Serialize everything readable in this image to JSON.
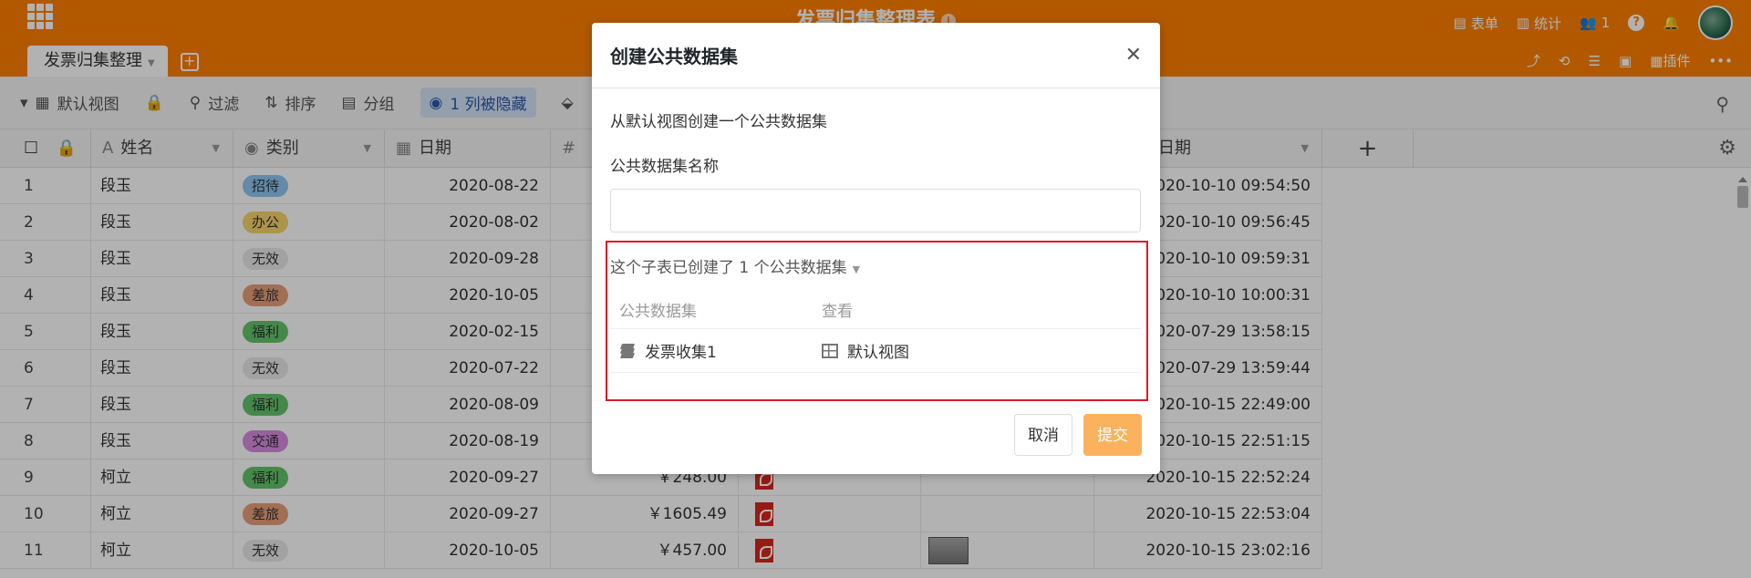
{
  "app": {
    "title": "发票归集整理表",
    "top_right": {
      "form": "表单",
      "stats": "统计",
      "users_count": "1",
      "plugins": "插件"
    },
    "tab": "发票归集整理"
  },
  "toolbar": {
    "view": "默认视图",
    "filter": "过滤",
    "sort": "排序",
    "group": "分组",
    "hidden": "1 列被隐藏"
  },
  "columns": {
    "name": "姓名",
    "category": "类别",
    "date": "日期",
    "last_date": "日期"
  },
  "rows": [
    {
      "no": "1",
      "name": "段玉",
      "cat": "招待",
      "cat_color": "#8fc6f3",
      "date": "2020-08-22",
      "amount": "",
      "pdf": false,
      "img": false,
      "dt": "2020-10-10 09:54:50"
    },
    {
      "no": "2",
      "name": "段玉",
      "cat": "办公",
      "cat_color": "#f7d56b",
      "date": "2020-08-02",
      "amount": "",
      "pdf": false,
      "img": false,
      "dt": "2020-10-10 09:56:45"
    },
    {
      "no": "3",
      "name": "段玉",
      "cat": "无效",
      "cat_color": "#e8e8e8",
      "date": "2020-09-28",
      "amount": "",
      "pdf": false,
      "img": false,
      "dt": "2020-10-10 09:59:31"
    },
    {
      "no": "4",
      "name": "段玉",
      "cat": "差旅",
      "cat_color": "#e9a07a",
      "date": "2020-10-05",
      "amount": "",
      "pdf": false,
      "img": false,
      "dt": "2020-10-10 10:00:31"
    },
    {
      "no": "5",
      "name": "段玉",
      "cat": "福利",
      "cat_color": "#63c56b",
      "date": "2020-02-15",
      "amount": "",
      "pdf": false,
      "img": false,
      "dt": "2020-07-29 13:58:15"
    },
    {
      "no": "6",
      "name": "段玉",
      "cat": "无效",
      "cat_color": "#e8e8e8",
      "date": "2020-07-22",
      "amount": "",
      "pdf": false,
      "img": false,
      "dt": "2020-07-29 13:59:44"
    },
    {
      "no": "7",
      "name": "段玉",
      "cat": "福利",
      "cat_color": "#63c56b",
      "date": "2020-08-09",
      "amount": "",
      "pdf": false,
      "img": false,
      "dt": "2020-10-15 22:49:00"
    },
    {
      "no": "8",
      "name": "段玉",
      "cat": "交通",
      "cat_color": "#d88be3",
      "date": "2020-08-19",
      "amount": "",
      "pdf": false,
      "img": false,
      "dt": "2020-10-15 22:51:15"
    },
    {
      "no": "9",
      "name": "柯立",
      "cat": "福利",
      "cat_color": "#63c56b",
      "date": "2020-09-27",
      "amount": "￥248.00",
      "pdf": true,
      "img": false,
      "dt": "2020-10-15 22:52:24"
    },
    {
      "no": "10",
      "name": "柯立",
      "cat": "差旅",
      "cat_color": "#e9a07a",
      "date": "2020-09-27",
      "amount": "￥1605.49",
      "pdf": true,
      "img": false,
      "dt": "2020-10-15 22:53:04"
    },
    {
      "no": "11",
      "name": "柯立",
      "cat": "无效",
      "cat_color": "#e8e8e8",
      "date": "2020-10-05",
      "amount": "￥457.00",
      "pdf": true,
      "img": true,
      "dt": "2020-10-15 23:02:16"
    }
  ],
  "modal": {
    "title": "创建公共数据集",
    "description": "从默认视图创建一个公共数据集",
    "name_label": "公共数据集名称",
    "name_value": "",
    "name_placeholder": "",
    "existing_summary": "这个子表已创建了 1 个公共数据集",
    "table_headers": {
      "dataset": "公共数据集",
      "view": "查看"
    },
    "datasets": [
      {
        "name": "发票收集1",
        "view": "默认视图"
      }
    ],
    "cancel": "取消",
    "submit": "提交"
  }
}
